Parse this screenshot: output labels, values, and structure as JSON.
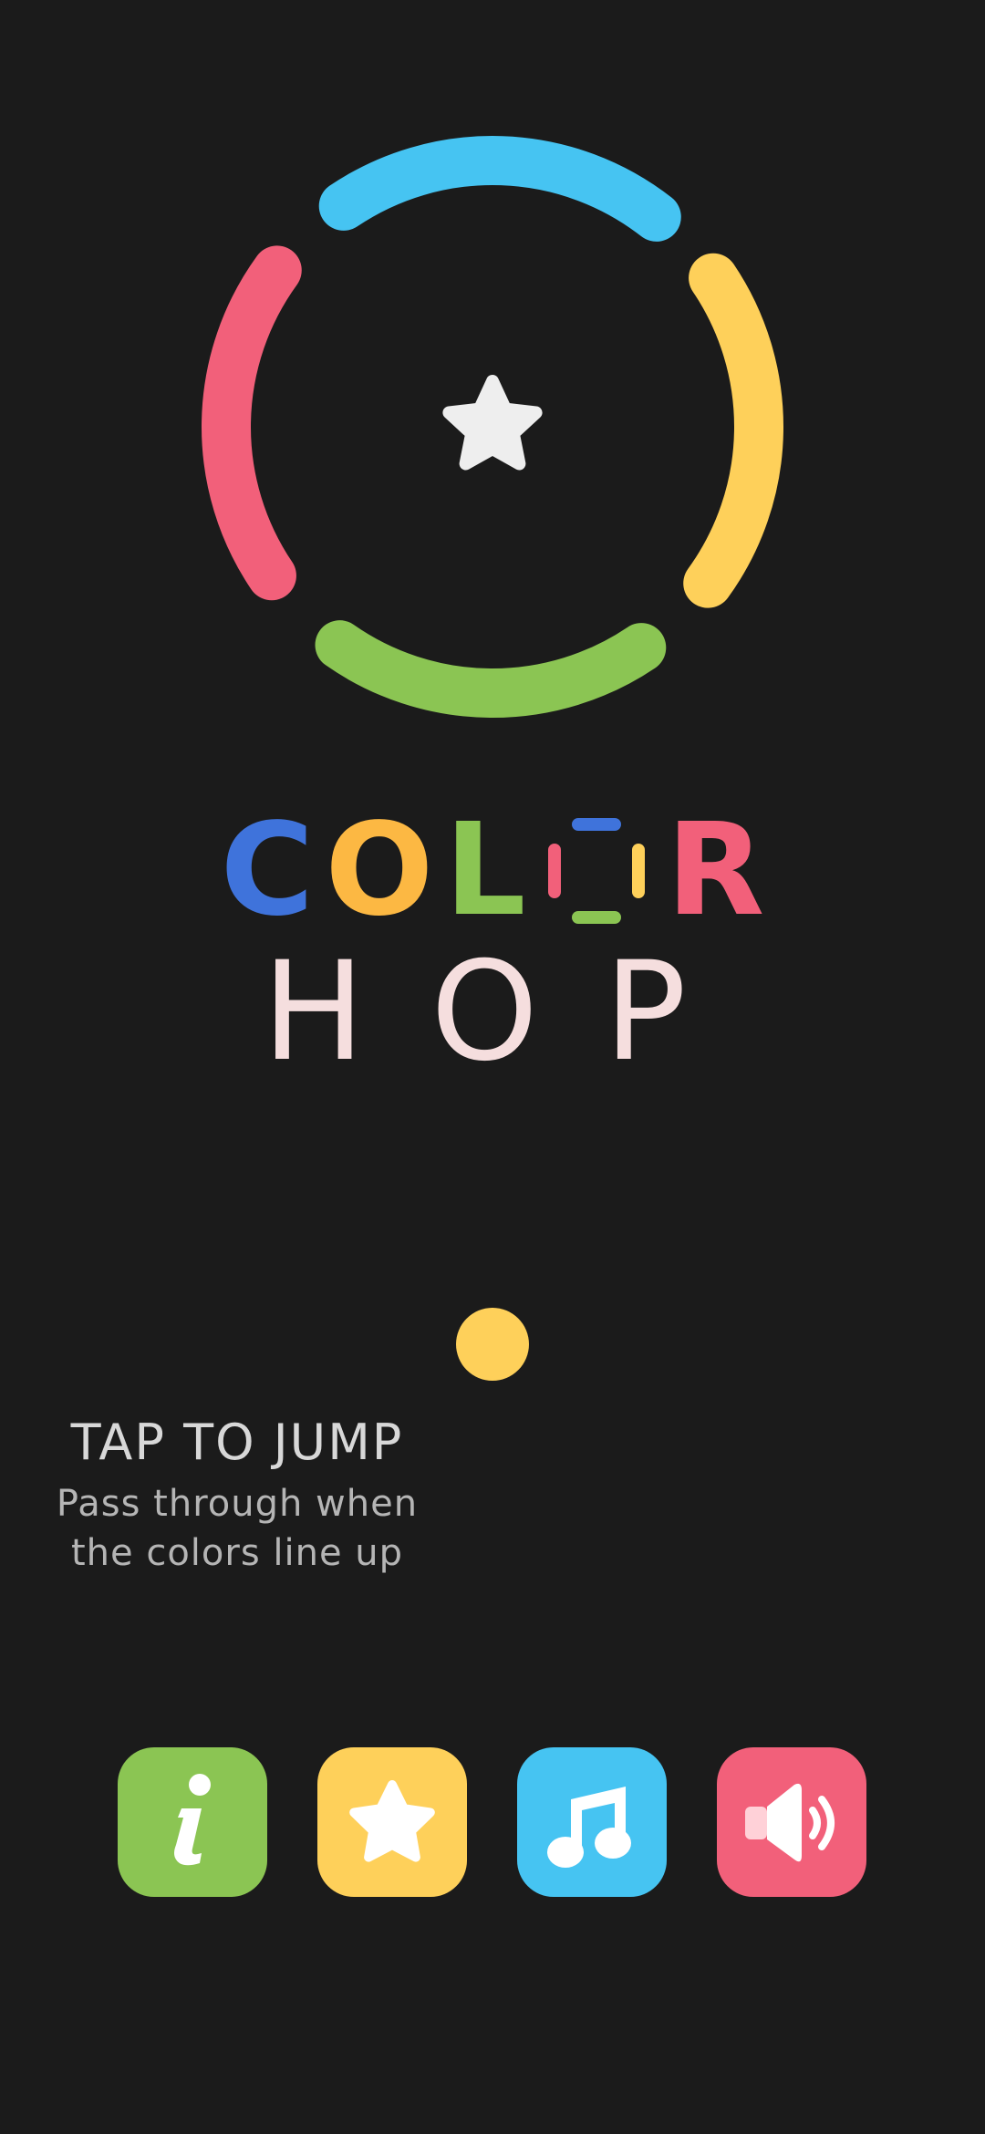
{
  "colors": {
    "background": "#1b1b1b",
    "cyan": "#46c4f2",
    "yellow": "#fed05a",
    "green": "#8bc553",
    "pink": "#f2607a",
    "blue": "#3f73db",
    "orange": "#fcb843",
    "title_hop": "#f5dede",
    "star": "#eeeeee"
  },
  "ring": {
    "segments": [
      {
        "name": "ring-segment-top",
        "color": "#46c4f2"
      },
      {
        "name": "ring-segment-right",
        "color": "#fed05a"
      },
      {
        "name": "ring-segment-bottom",
        "color": "#8bc553"
      },
      {
        "name": "ring-segment-left",
        "color": "#f2607a"
      }
    ],
    "center_icon": "star-icon"
  },
  "title": {
    "line1": [
      {
        "char": "C",
        "color": "#3f73db"
      },
      {
        "char": "O",
        "color": "#fcb843"
      },
      {
        "char": "L",
        "color": "#8bc553"
      },
      {
        "char": "R",
        "color": "#f2607a"
      }
    ],
    "line2": [
      "H",
      "O",
      "P"
    ]
  },
  "player_ball": {
    "color": "#fed05a"
  },
  "hint": {
    "title": "TAP TO JUMP",
    "line1": "Pass through when",
    "line2": "the colors line up"
  },
  "buttons": [
    {
      "name": "info-button",
      "icon": "info-icon",
      "color": "#8bc553"
    },
    {
      "name": "rate-button",
      "icon": "star-icon",
      "color": "#fed05a"
    },
    {
      "name": "music-button",
      "icon": "music-note-icon",
      "color": "#46c4f2"
    },
    {
      "name": "sound-button",
      "icon": "speaker-icon",
      "color": "#f2607a"
    }
  ]
}
